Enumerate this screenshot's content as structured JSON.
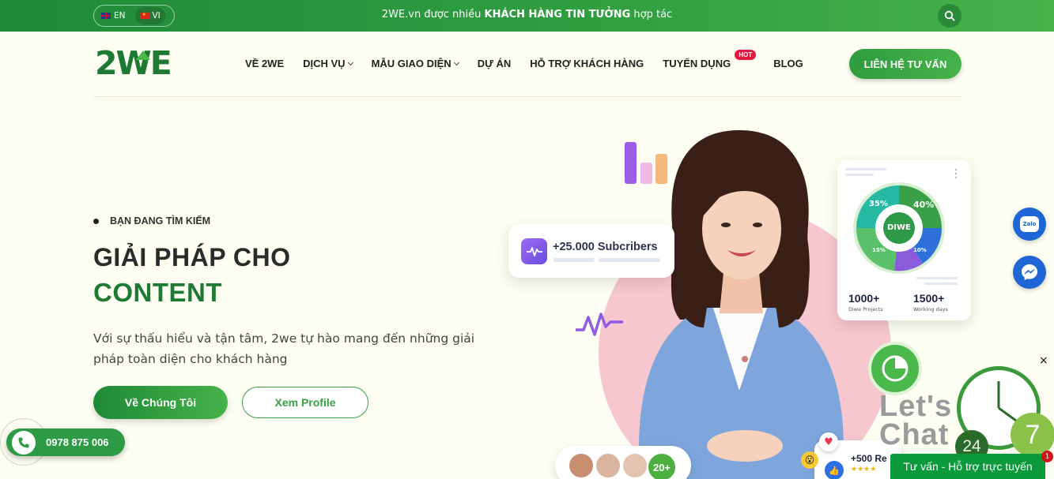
{
  "topbar": {
    "languages": [
      {
        "code": "EN",
        "flag": "uk-flag-icon",
        "active": false
      },
      {
        "code": "VI",
        "flag": "vn-flag-icon",
        "active": true
      }
    ],
    "message_prefix": "2WE.vn được nhiều ",
    "message_bold": "KHÁCH HÀNG TIN TƯỞNG",
    "message_suffix": " hợp tác",
    "search_icon": "search-icon"
  },
  "header": {
    "logo_text": "2WE",
    "nav": [
      {
        "label": "VỀ 2WE",
        "dropdown": false
      },
      {
        "label": "DỊCH VỤ",
        "dropdown": true
      },
      {
        "label": "MẪU GIAO DIỆN",
        "dropdown": true
      },
      {
        "label": "DỰ ÁN",
        "dropdown": false
      },
      {
        "label": "HỖ TRỢ KHÁCH HÀNG",
        "dropdown": false
      },
      {
        "label": "TUYỂN DỤNG",
        "dropdown": false,
        "badge": "HOT"
      },
      {
        "label": "BLOG",
        "dropdown": false
      }
    ],
    "cta_label": "LIÊN HỆ TƯ VẤN"
  },
  "hero": {
    "eyebrow": "BẠN ĐANG TÌM KIẾM",
    "title_line1": "GIẢI PHÁP CHO",
    "title_line2": "CONTENT",
    "description": "Với sự thấu hiểu và tận tâm, 2we tự hào mang đến những giải pháp toàn diện cho khách hàng",
    "primary_button": "Về Chúng Tôi",
    "secondary_button": "Xem Profile"
  },
  "visuals": {
    "subscribers": "+25.000 Subcribers",
    "stats": {
      "pct_a": "35%",
      "pct_b": "40%",
      "pct_c": "15%",
      "pct_d": "10%",
      "center_logo": "DIWE",
      "projects_num": "1000+",
      "projects_label": "Diwe Projects",
      "days_num": "1500+",
      "days_label": "Working days"
    },
    "avatars_more": "20+",
    "reviews": "+500 Re"
  },
  "contact": {
    "phone": "0978 875 006"
  },
  "chat": {
    "lets": "Let's",
    "chat": "Chat",
    "n24": "24",
    "n7": "7",
    "bar_label": "Tư vấn - Hỗ trợ trực tuyến",
    "badge": "1",
    "close": "×"
  },
  "colors": {
    "brand_green": "#1e7a33",
    "accent_green": "#46b24a",
    "hot_red": "#e3183c",
    "pink": "#f6c7ce"
  }
}
